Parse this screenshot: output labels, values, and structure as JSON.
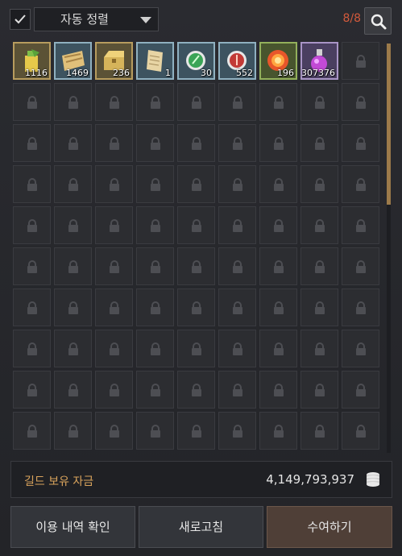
{
  "toolbar": {
    "auto_sort_checked": true,
    "auto_sort_label": "자동 정렬",
    "page_count": "8/8"
  },
  "inventory": {
    "items": [
      {
        "icon": "potion-icon",
        "qty": "1116",
        "rarity": "gold"
      },
      {
        "icon": "map-scroll-icon",
        "qty": "1469",
        "rarity": "blue"
      },
      {
        "icon": "treasure-chest-icon",
        "qty": "236",
        "rarity": "gold"
      },
      {
        "icon": "scroll-icon",
        "qty": "1",
        "rarity": "blue"
      },
      {
        "icon": "green-orb-icon",
        "qty": "30",
        "rarity": "blue"
      },
      {
        "icon": "red-orb-icon",
        "qty": "552",
        "rarity": "blue"
      },
      {
        "icon": "fire-orb-icon",
        "qty": "196",
        "rarity": "green"
      },
      {
        "icon": "purple-potion-icon",
        "qty": "307376",
        "rarity": "purple"
      }
    ],
    "columns": 9,
    "rows": 10
  },
  "funds": {
    "label": "길드 보유 자금",
    "value": "4,149,793,937",
    "icon": "coin-stack-icon"
  },
  "buttons": {
    "history": "이용 내역 확인",
    "refresh": "새로고침",
    "donate": "수여하기"
  },
  "colors": {
    "count": "#d35a3c",
    "funds_label": "#d9a35c",
    "scroll_thumb": "#9c7a4a"
  }
}
